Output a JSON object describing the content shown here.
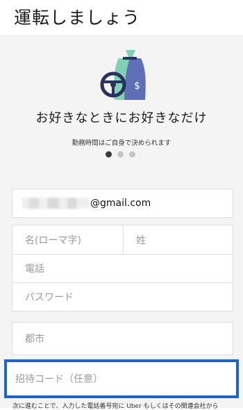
{
  "header": {
    "title": "運転しましょう"
  },
  "hero": {
    "headline": "お好きなときにお好きなだけ",
    "subtext": "勤務時間はご自身で決められます",
    "pagination": {
      "count": 3,
      "active": 0
    },
    "illustration": {
      "icons": [
        "steering-wheel-icon",
        "money-bag-icon"
      ],
      "colors": {
        "bag": "#5e6fb8",
        "accent": "#7fd2b3",
        "wheel": "#27325f"
      }
    }
  },
  "form": {
    "email": {
      "value_suffix": "@gmail.com"
    },
    "first_name": {
      "placeholder": "名(ローマ字)"
    },
    "last_name": {
      "placeholder": "姓"
    },
    "phone": {
      "placeholder": "電話"
    },
    "password": {
      "placeholder": "パスワード"
    },
    "city": {
      "placeholder": "都市"
    },
    "invite_code": {
      "placeholder": "招待コード（任意）"
    }
  },
  "footer": {
    "text": "次に進むことで、入力した電話番号宛に Uber もしくはその関連会社から"
  },
  "colors": {
    "highlight": "#1f63c6",
    "background": "#f4f4f4"
  }
}
